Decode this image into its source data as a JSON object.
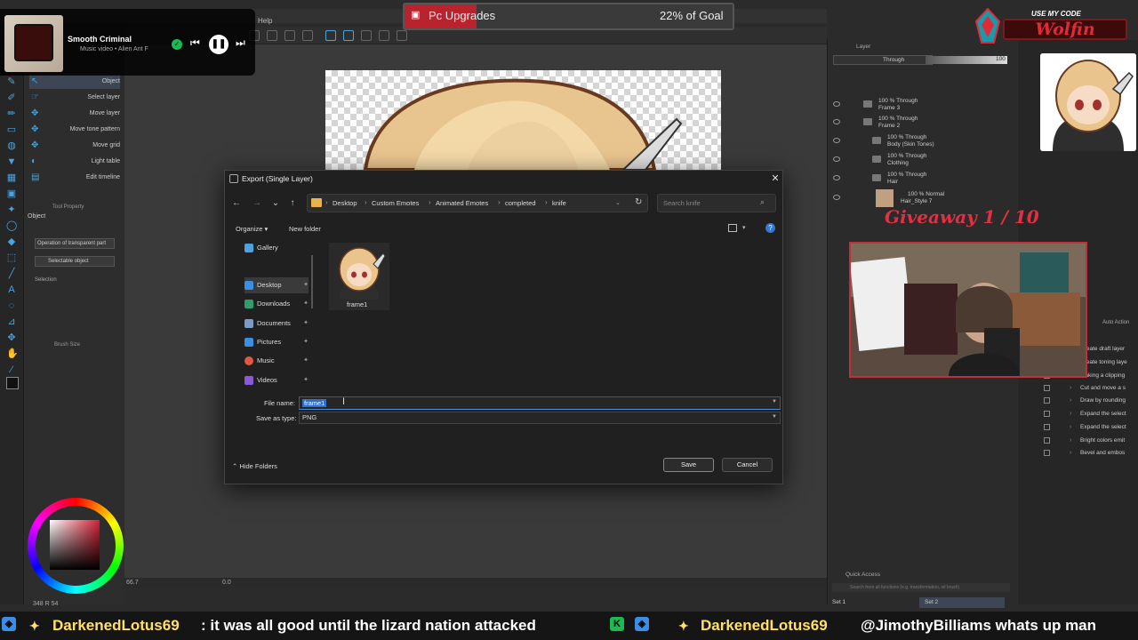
{
  "app": {
    "menu_help": "Help",
    "subtools": [
      {
        "label": "Object",
        "icon": "arrow-icon"
      },
      {
        "label": "Select layer",
        "icon": "hand-pointer-icon"
      },
      {
        "label": "Move layer",
        "icon": "move-icon"
      },
      {
        "label": "Move tone pattern",
        "icon": "move-icon"
      },
      {
        "label": "Move grid",
        "icon": "move-icon"
      },
      {
        "label": "Light table",
        "icon": "light-table-icon"
      },
      {
        "label": "Edit timeline",
        "icon": "timeline-icon"
      }
    ],
    "tool_property_title": "Tool Property",
    "tool_property_object": "Object",
    "tool_property_dropdown1": "Operation of transparent part",
    "tool_property_dropdown2": "Selectable object",
    "tool_property_selection": "Selection",
    "brush_size_title": "Brush Size",
    "layer_panel_title": "Layer",
    "blend_mode": "Through",
    "opacity": "100",
    "layers": [
      {
        "pct": "100 % Through",
        "name": "Frame 3"
      },
      {
        "pct": "100 % Through",
        "name": "Frame 2"
      },
      {
        "pct": "100 % Through",
        "name": "Body (Skin Tones)"
      },
      {
        "pct": "100 % Through",
        "name": "Clothing"
      },
      {
        "pct": "100 % Through",
        "name": "Hair"
      },
      {
        "pct": "100 % Normal",
        "name": "Hair_Style 7"
      }
    ],
    "auto_action_title": "Auto Action",
    "actions": [
      "Create draft layer",
      "Create toning laye",
      "Making a clipping",
      "Cut and move a s",
      "Draw by rounding",
      "Expand the select",
      "Expand the select",
      "Bright colors emit",
      "Bevel and embos"
    ],
    "quick_access_title": "Quick Access",
    "quick_access_search": "Search from all functions (e.g. transformation, oil brush)",
    "set1": "Set 1",
    "set2": "Set 2",
    "zoom": "66.7",
    "rotation": "0.0",
    "color_value": "348 R 54"
  },
  "now_playing": {
    "title": "Smooth Criminal",
    "subtitle": "Music video • Alien Ant F"
  },
  "goal": {
    "name": "Pc Upgrades",
    "percent_text": "22% of Goal",
    "progress_fraction": 0.22,
    "fill_color": "#b8232d"
  },
  "creator_code": {
    "label": "USE MY CODE",
    "code": "Wolfin"
  },
  "giveaway": "Giveaway 1 / 10",
  "dialog": {
    "title": "Export (Single Layer)",
    "breadcrumbs": [
      "Desktop",
      "Custom Emotes",
      "Animated Emotes",
      "completed",
      "knife"
    ],
    "search_placeholder": "Search knife",
    "organize": "Organize",
    "new_folder": "New folder",
    "nav_items": [
      {
        "label": "Gallery",
        "icon": "gallery-icon",
        "color": "#4aa3df",
        "pinned": false
      },
      {
        "label": "Desktop",
        "icon": "desktop-icon",
        "color": "#3a8ee6",
        "pinned": true
      },
      {
        "label": "Downloads",
        "icon": "download-icon",
        "color": "#2f9e6a",
        "pinned": true
      },
      {
        "label": "Documents",
        "icon": "documents-icon",
        "color": "#7a9cc6",
        "pinned": true
      },
      {
        "label": "Pictures",
        "icon": "pictures-icon",
        "color": "#3a8ee6",
        "pinned": true
      },
      {
        "label": "Music",
        "icon": "music-icon",
        "color": "#e2573f",
        "pinned": true
      },
      {
        "label": "Videos",
        "icon": "videos-icon",
        "color": "#8a5bd6",
        "pinned": true
      }
    ],
    "files": [
      {
        "name": "frame1"
      }
    ],
    "file_name_label": "File name:",
    "file_name_value": "frame1",
    "save_as_type_label": "Save as type:",
    "save_as_type_value": "PNG",
    "hide_folders": "Hide Folders",
    "save": "Save",
    "cancel": "Cancel"
  },
  "ticker": [
    {
      "user": "DarkenedLotus69",
      "message": ": it was all good until the lizard nation attacked"
    },
    {
      "user": "DarkenedLotus69",
      "message": "@JimothyBilliams whats up man"
    }
  ]
}
